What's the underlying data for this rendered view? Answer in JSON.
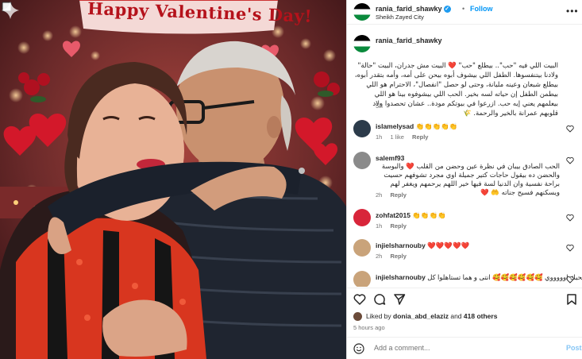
{
  "post": {
    "username": "rania_farid_shawky",
    "verified_symbol": "✓",
    "dot": "•",
    "follow_label": "Follow",
    "location": "Sheikh Zayed City",
    "more_symbol": "•••",
    "banner_text": "Happy Valentine's Day!"
  },
  "caption": {
    "username": "rania_farid_shawky",
    "text": "البيت اللي فيه \"حب\".. بيطلع \"حب\" ❤️ البيت مش جدران، البيت \"حالة\" ولادنا بيتنفسوها. الطفل اللي بيشوف أبوه بيحن على أمه، وأمه بتقدر أبوه، بيطلع شبعان وعينه مليانة، وحتى لو حصل \"انفصال\"، الاحترام هو اللي بيطمن الطفل إن حياته لسه بخير. الحب اللي بيشوفوه بينا هو اللي بيعلمهم يعني إيه حب. ازرعوا في بيوتكم مودة.. عشان تحصدوا ولاد قلوبهم عمرانة بالخير والرحمة. 🌾",
    "time": "5h"
  },
  "comments": [
    {
      "user": "islamelysad",
      "text": "👏👏👏👏👏",
      "time": "1h",
      "likes": "1 like",
      "reply": "Reply"
    },
    {
      "user": "salemf93",
      "text": "الحب الصادق بيبان في نظرة عين وحضن من القلب ❤️ والبوسة والحضن ده بيقول حاجات كتير جميلة اوي مجرد تشوفهم حسيت براحة نفسية وان الدنيا لسة فيها خير اللهم يرحمهم ويغفر لهم ويسكنهم فسيح جناته 🤲 ❤️",
      "time": "2h",
      "reply": "Reply"
    },
    {
      "user": "zohfat2015",
      "text": "👏👏👏👏",
      "time": "1h",
      "reply": "Reply"
    },
    {
      "user": "injielsharnouby",
      "text": "❤️❤️❤️❤️❤️",
      "time": "2h",
      "reply": "Reply"
    },
    {
      "user": "injielsharnouby",
      "text": "أنا بحبك اوووووي 🥰🥰🥰🥰🥰🥰 انتى و هما تستاهلوا كل",
      "time": "",
      "reply": ""
    }
  ],
  "likes": {
    "prefix": "Liked by",
    "user": "donia_abd_elaziz",
    "middle": "and",
    "others": "418 others"
  },
  "post_time": "5 hours ago",
  "add_comment": {
    "placeholder": "Add a comment...",
    "post_label": "Post"
  },
  "icons": {
    "like": "heart-icon",
    "comment": "comment-icon",
    "share": "share-icon",
    "save": "bookmark-icon",
    "emoji": "emoji-icon",
    "comment_like": "heart-outline-icon"
  },
  "colors": {
    "accent": "#0095f6",
    "verified": "#1d9bf0",
    "muted": "#737373",
    "post_disabled": "#85c5f5"
  }
}
